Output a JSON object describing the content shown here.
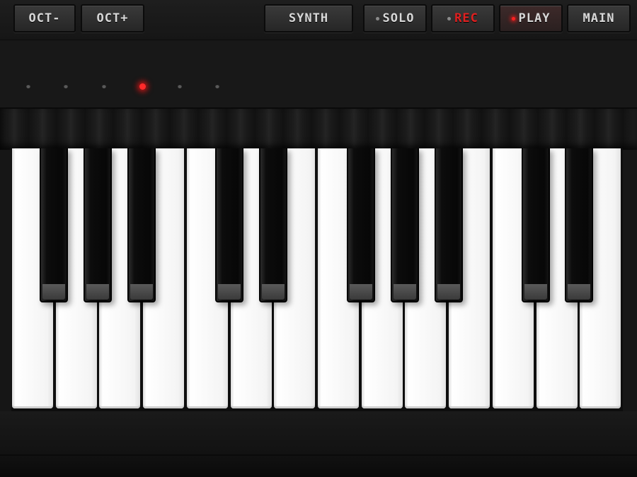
{
  "toolbar": {
    "oct_minus_label": "OCT-",
    "oct_plus_label": "OCT+",
    "synth_label": "SYNTH",
    "solo_label": "SOLO",
    "rec_label": "REC",
    "play_label": "PLAY",
    "main_label": "MAIN"
  },
  "octave_indicator": {
    "count": 6,
    "active_index": 3
  },
  "keyboard": {
    "white_key_count": 14,
    "black_key_count": 10,
    "white_key_color": "#f4f4f4",
    "black_key_color": "#0a0a0a"
  },
  "colors": {
    "led_active": "#ff2020",
    "rec_text": "#e02020",
    "button_text": "#d8d8d8",
    "background": "#161616"
  },
  "states": {
    "solo_led_on": false,
    "rec_led_on": false,
    "play_led_on": true
  }
}
